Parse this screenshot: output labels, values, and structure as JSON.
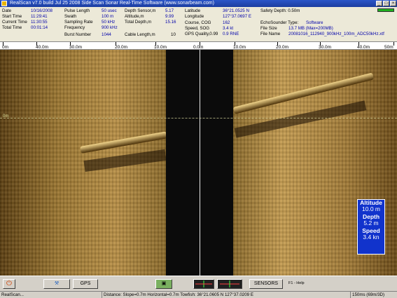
{
  "window": {
    "title": "RealScan v7.0 build Jul 25 2008 Side Scan Sonar Real-Time Software (www.sonarbeam.com)",
    "minimize": "_",
    "maximize": "□",
    "close": "×"
  },
  "info": {
    "col1": [
      {
        "label": "Date",
        "value": "10/16/2008"
      },
      {
        "label": "Start Time",
        "value": "11:29:41"
      },
      {
        "label": "Current Time",
        "value": "11:30:55"
      },
      {
        "label": "Total Time",
        "value": "00:01:14"
      }
    ],
    "col2": [
      {
        "label": "Pulse Length",
        "value": "50 usec"
      },
      {
        "label": "Swath",
        "value": "100 m"
      },
      {
        "label": "Sampling Rate",
        "value": "50 kHz"
      },
      {
        "label": "Frequency",
        "value": "900 kHz"
      },
      {
        "label": "Burst Number",
        "value": "1044"
      }
    ],
    "col3": [
      {
        "label": "Depth Sensor,m",
        "value": "5.17"
      },
      {
        "label": "Altitude,m",
        "value": "9.99"
      },
      {
        "label": "Total Depth,m",
        "value": "15.16"
      },
      {
        "label": "",
        "value": ""
      },
      {
        "label": "Cable Length,m",
        "value": "10"
      }
    ],
    "col4": [
      {
        "label": "Latitude",
        "value": "36°21.0525 N"
      },
      {
        "label": "Longitude",
        "value": "127°37.0697 E"
      },
      {
        "label": "Course, COG",
        "value": "162"
      },
      {
        "label": "Speed, SOG",
        "value": "3.4 kt"
      },
      {
        "label": "GPS Quality,0.99",
        "value": "0.9 RNE"
      }
    ],
    "col5": [
      {
        "label": "Safety Depth: 0.50m",
        "value": ""
      },
      {
        "label": "",
        "value": ""
      },
      {
        "label": "EchoSounder Type:",
        "value": "Software"
      },
      {
        "label": "File Size",
        "value": "13.7 MB (Max=200MB)"
      },
      {
        "label": "File Name",
        "value": "20081016_112940_900kHz_100m_ADC50kHz.xtf"
      }
    ]
  },
  "ruler": {
    "labels": [
      "0m",
      "40.0m",
      "30.0m",
      "20.0m",
      "10.0m",
      "0.0m",
      "10.0m",
      "20.0m",
      "30.0m",
      "40.0m",
      "50m"
    ]
  },
  "sonar": {
    "marker_label": "0m"
  },
  "nav": {
    "altitude_label": "Altitude",
    "altitude_value": "10.0 m",
    "depth_label": "Depth",
    "depth_value": "5.2 m",
    "speed_label": "Speed",
    "speed_value": "3.4 kn"
  },
  "toolbar": {
    "power": "⏻",
    "tools": "⚒",
    "gps": "GPS",
    "camera": "▣",
    "sensors": "SENSORS",
    "help": "F1 - Help"
  },
  "status": {
    "app": "RealScan...",
    "distance": "Distance: Slope=0.7m Horizontal=0.7m Towfish: 36°21.0605 N  127°37.0209 E",
    "range": "150ms (69m/3D)"
  }
}
